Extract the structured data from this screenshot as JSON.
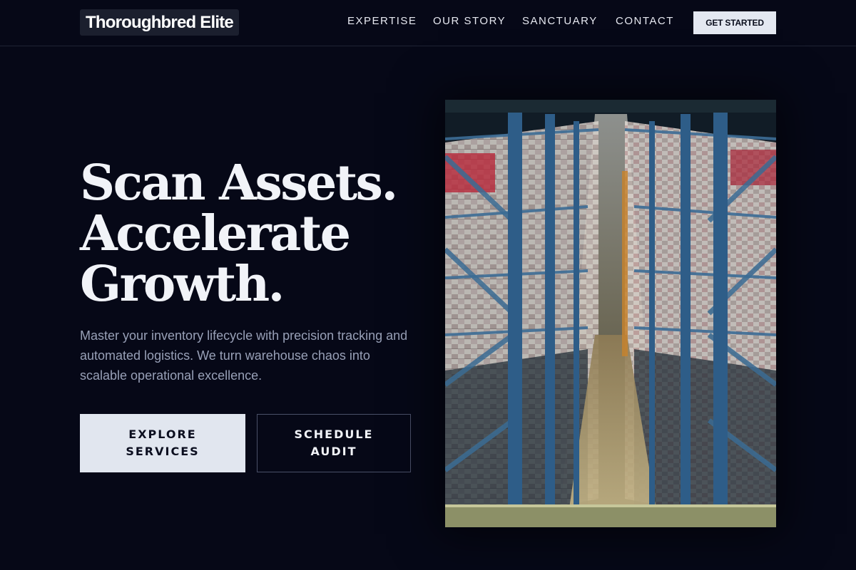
{
  "brand": {
    "name": "Thoroughbred Elite"
  },
  "nav": {
    "items": [
      {
        "label": "EXPERTISE"
      },
      {
        "label": "OUR STORY"
      },
      {
        "label": "SANCTUARY"
      },
      {
        "label": "CONTACT"
      }
    ],
    "cta_label": "GET STARTED"
  },
  "hero": {
    "headline": [
      "Scan Assets.",
      "Accelerate",
      "Growth."
    ],
    "lede": "Master your inventory lifecycle with precision tracking and automated logistics. We turn warehouse chaos into scalable operational excellence.",
    "primary_button": "EXPLORE SERVICES",
    "secondary_button": "SCHEDULE AUDIT",
    "image_subject": "warehouse-racking-aisle-photo"
  },
  "colors": {
    "background": "#060817",
    "accent_light": "#e1e6ef",
    "muted_text": "#98a0b7",
    "rack_blue": "#3a6a96"
  }
}
